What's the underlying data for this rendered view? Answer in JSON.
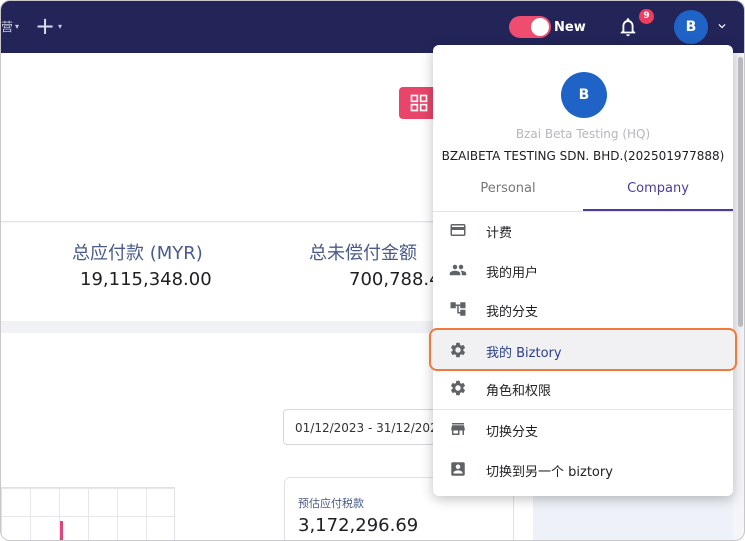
{
  "topbar": {
    "nav_fragment": "营",
    "plus": "+",
    "toggle_label": "New",
    "notification_count": "9",
    "user_initial": "B"
  },
  "stats": {
    "total_payable_label": "总应付款 (MYR)",
    "total_payable_value": "19,115,348.00",
    "total_unpaid_label": "总未偿付金额",
    "total_unpaid_value": "700,788.4"
  },
  "filters": {
    "date_range": "01/12/2023 - 31/12/2023"
  },
  "tax_card": {
    "label": "预估应付税款",
    "value": "3,172,296.69"
  },
  "account_menu": {
    "avatar_initial": "B",
    "org_subtitle": "Bzai Beta Testing (HQ)",
    "org_name": "BZAIBETA TESTING SDN. BHD.(202501977888)",
    "tabs": [
      {
        "label": "Personal",
        "active": false
      },
      {
        "label": "Company",
        "active": true
      }
    ],
    "items": [
      {
        "label": "计费",
        "icon": "credit-card-icon"
      },
      {
        "label": "我的用户",
        "icon": "people-icon"
      },
      {
        "label": "我的分支",
        "icon": "branch-tree-icon"
      },
      {
        "label": "我的 Biztory",
        "icon": "gear-icon"
      },
      {
        "label": "角色和权限",
        "icon": "gear-icon"
      },
      {
        "label": "切换分支",
        "icon": "store-icon"
      },
      {
        "label": "切换到另一个 biztory",
        "icon": "account-box-icon"
      }
    ]
  },
  "colors": {
    "topbar": "#232559",
    "accent_pink": "#e9446a",
    "avatar_blue": "#1f63c6",
    "tab_active": "#4a3c9c",
    "highlight_border": "#f07a3c"
  }
}
